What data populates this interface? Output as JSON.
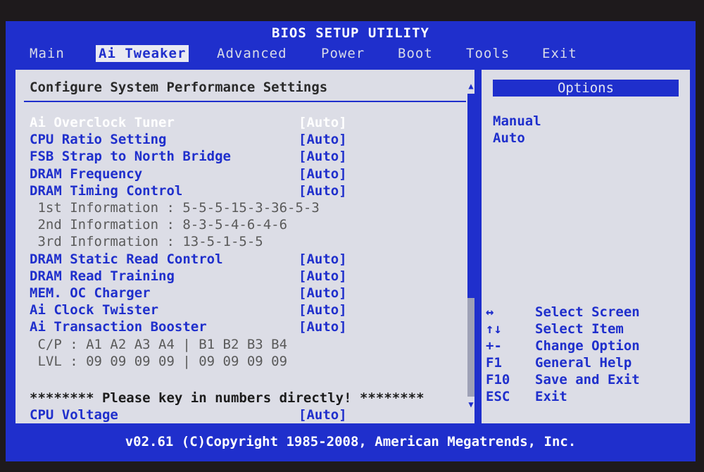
{
  "title": "BIOS SETUP UTILITY",
  "menu": [
    "Main",
    "Ai Tweaker",
    "Advanced",
    "Power",
    "Boot",
    "Tools",
    "Exit"
  ],
  "active_menu": "Ai Tweaker",
  "main": {
    "heading": "Configure System Performance Settings",
    "rows": [
      {
        "type": "setting",
        "selected": true,
        "label": "Ai Overclock Tuner",
        "value": "[Auto]"
      },
      {
        "type": "setting",
        "label": "CPU Ratio Setting",
        "value": "[Auto]"
      },
      {
        "type": "setting",
        "label": "FSB Strap to North Bridge",
        "value": "[Auto]"
      },
      {
        "type": "setting",
        "label": "DRAM Frequency",
        "value": "[Auto]"
      },
      {
        "type": "setting",
        "label": "DRAM Timing Control",
        "value": "[Auto]"
      },
      {
        "type": "info",
        "text": " 1st Information : 5-5-5-15-3-36-5-3"
      },
      {
        "type": "info",
        "text": " 2nd Information : 8-3-5-4-6-4-6"
      },
      {
        "type": "info",
        "text": " 3rd Information : 13-5-1-5-5"
      },
      {
        "type": "setting",
        "label": "DRAM Static Read Control",
        "value": "[Auto]"
      },
      {
        "type": "setting",
        "label": "DRAM Read Training",
        "value": "[Auto]"
      },
      {
        "type": "setting",
        "label": "MEM. OC Charger",
        "value": "[Auto]"
      },
      {
        "type": "setting",
        "label": "Ai Clock Twister",
        "value": "[Auto]"
      },
      {
        "type": "setting",
        "label": "Ai Transaction Booster",
        "value": "[Auto]"
      },
      {
        "type": "info",
        "text": " C/P : A1 A2 A3 A4 | B1 B2 B3 B4"
      },
      {
        "type": "info",
        "text": " LVL : 09 09 09 09 | 09 09 09 09"
      },
      {
        "type": "blank"
      },
      {
        "type": "warning",
        "text": "******** Please key in numbers directly! ********"
      },
      {
        "type": "setting",
        "label": "CPU Voltage",
        "value": "[Auto]"
      }
    ]
  },
  "options": {
    "header": "Options",
    "items": [
      "Manual",
      "Auto"
    ]
  },
  "help": [
    {
      "key": "↔",
      "text": "Select Screen"
    },
    {
      "key": "↑↓",
      "text": "Select Item"
    },
    {
      "key": "+-",
      "text": "Change Option"
    },
    {
      "key": "F1",
      "text": "General Help"
    },
    {
      "key": "F10",
      "text": "Save and Exit"
    },
    {
      "key": "ESC",
      "text": "Exit"
    }
  ],
  "footer": "v02.61 (C)Copyright 1985-2008, American Megatrends, Inc.",
  "colors": {
    "bios_blue": "#1f2fcc",
    "panel": "#dcdde6",
    "selected_text": "#ffffff"
  }
}
